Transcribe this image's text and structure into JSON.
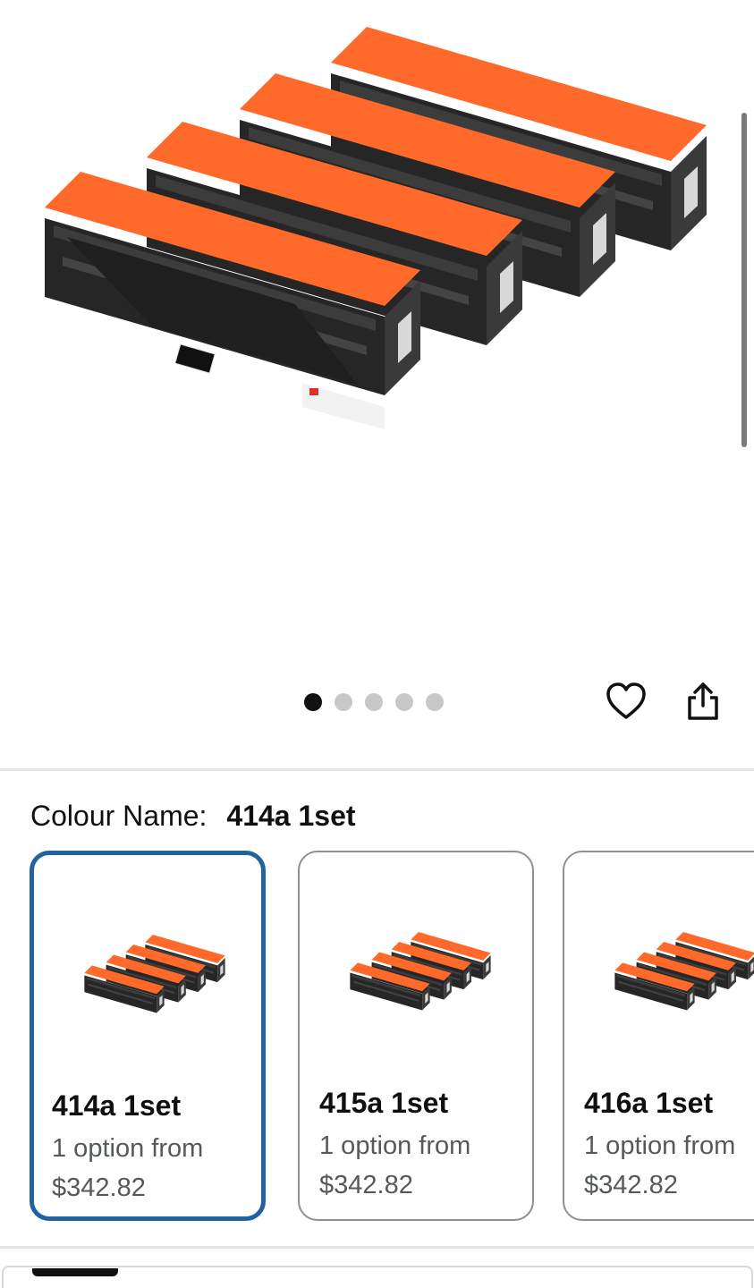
{
  "gallery": {
    "image_alt": "toner-cartridge-set",
    "dots": [
      true,
      false,
      false,
      false,
      false
    ],
    "heart_icon": "heart-icon",
    "share_icon": "share-icon"
  },
  "variation": {
    "label": "Colour Name:",
    "value": "414a 1set"
  },
  "swatches": [
    {
      "title": "414a 1set",
      "sub": "1 option from",
      "price": "$342.82",
      "selected": true
    },
    {
      "title": "415a 1set",
      "sub": "1 option from",
      "price": "$342.82",
      "selected": false
    },
    {
      "title": "416a 1set",
      "sub": "1 option from",
      "price": "$342.82",
      "selected": false
    }
  ],
  "colors": {
    "accent_orange": "#ff6a2b",
    "selected_border": "#2162a1",
    "cartridge_body": "#2b2b2b"
  }
}
